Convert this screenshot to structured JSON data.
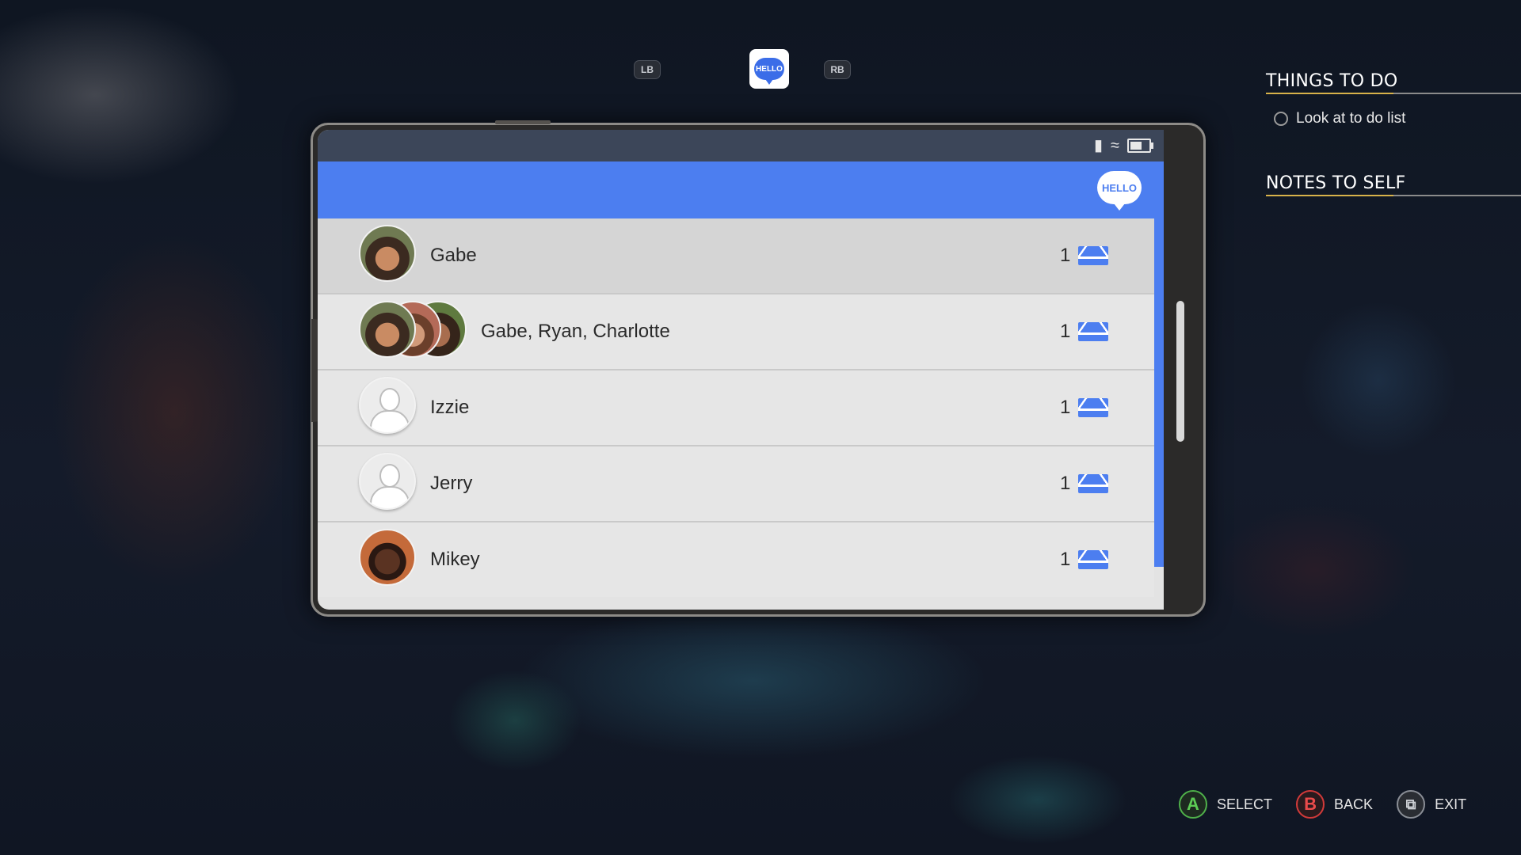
{
  "tabs": {
    "left_bumper": "LB",
    "right_bumper": "RB",
    "active_app": "HELLO"
  },
  "phone": {
    "app_logo": "HELLO",
    "conversations": [
      {
        "name": "Gabe",
        "unread": "1",
        "avatar": "gabe-photo",
        "selected": true
      },
      {
        "name": "Gabe, Ryan, Charlotte",
        "unread": "1",
        "avatar": "group-photo"
      },
      {
        "name": "Izzie",
        "unread": "1",
        "avatar": "default-silhouette"
      },
      {
        "name": "Jerry",
        "unread": "1",
        "avatar": "default-silhouette"
      },
      {
        "name": "Mikey",
        "unread": "1",
        "avatar": "mikey-photo"
      }
    ],
    "icons": [
      "signal-icon",
      "wifi-icon",
      "battery-icon",
      "mail-icon"
    ]
  },
  "side_panel": {
    "things_to_do_title": "THINGS TO DO",
    "todo_items": [
      "Look at to do list"
    ],
    "notes_title": "NOTES TO SELF"
  },
  "hints": {
    "select": "SELECT",
    "back": "BACK",
    "exit": "EXIT",
    "a": "A",
    "b": "B"
  },
  "colors": {
    "accent": "#4c7ef0",
    "statusbar": "#3c4659",
    "underline_gold": "#d8b24a"
  }
}
